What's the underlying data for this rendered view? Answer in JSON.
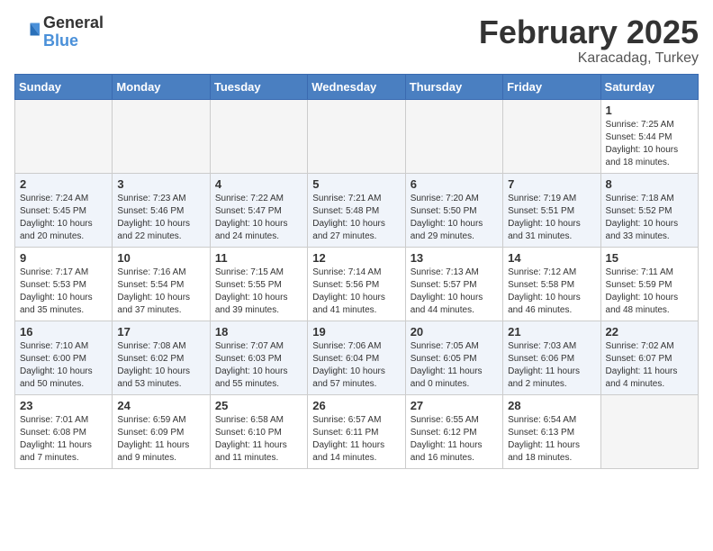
{
  "header": {
    "logo_general": "General",
    "logo_blue": "Blue",
    "month_title": "February 2025",
    "location": "Karacadag, Turkey"
  },
  "weekdays": [
    "Sunday",
    "Monday",
    "Tuesday",
    "Wednesday",
    "Thursday",
    "Friday",
    "Saturday"
  ],
  "weeks": [
    [
      {
        "day": "",
        "info": ""
      },
      {
        "day": "",
        "info": ""
      },
      {
        "day": "",
        "info": ""
      },
      {
        "day": "",
        "info": ""
      },
      {
        "day": "",
        "info": ""
      },
      {
        "day": "",
        "info": ""
      },
      {
        "day": "1",
        "info": "Sunrise: 7:25 AM\nSunset: 5:44 PM\nDaylight: 10 hours and 18 minutes."
      }
    ],
    [
      {
        "day": "2",
        "info": "Sunrise: 7:24 AM\nSunset: 5:45 PM\nDaylight: 10 hours and 20 minutes."
      },
      {
        "day": "3",
        "info": "Sunrise: 7:23 AM\nSunset: 5:46 PM\nDaylight: 10 hours and 22 minutes."
      },
      {
        "day": "4",
        "info": "Sunrise: 7:22 AM\nSunset: 5:47 PM\nDaylight: 10 hours and 24 minutes."
      },
      {
        "day": "5",
        "info": "Sunrise: 7:21 AM\nSunset: 5:48 PM\nDaylight: 10 hours and 27 minutes."
      },
      {
        "day": "6",
        "info": "Sunrise: 7:20 AM\nSunset: 5:50 PM\nDaylight: 10 hours and 29 minutes."
      },
      {
        "day": "7",
        "info": "Sunrise: 7:19 AM\nSunset: 5:51 PM\nDaylight: 10 hours and 31 minutes."
      },
      {
        "day": "8",
        "info": "Sunrise: 7:18 AM\nSunset: 5:52 PM\nDaylight: 10 hours and 33 minutes."
      }
    ],
    [
      {
        "day": "9",
        "info": "Sunrise: 7:17 AM\nSunset: 5:53 PM\nDaylight: 10 hours and 35 minutes."
      },
      {
        "day": "10",
        "info": "Sunrise: 7:16 AM\nSunset: 5:54 PM\nDaylight: 10 hours and 37 minutes."
      },
      {
        "day": "11",
        "info": "Sunrise: 7:15 AM\nSunset: 5:55 PM\nDaylight: 10 hours and 39 minutes."
      },
      {
        "day": "12",
        "info": "Sunrise: 7:14 AM\nSunset: 5:56 PM\nDaylight: 10 hours and 41 minutes."
      },
      {
        "day": "13",
        "info": "Sunrise: 7:13 AM\nSunset: 5:57 PM\nDaylight: 10 hours and 44 minutes."
      },
      {
        "day": "14",
        "info": "Sunrise: 7:12 AM\nSunset: 5:58 PM\nDaylight: 10 hours and 46 minutes."
      },
      {
        "day": "15",
        "info": "Sunrise: 7:11 AM\nSunset: 5:59 PM\nDaylight: 10 hours and 48 minutes."
      }
    ],
    [
      {
        "day": "16",
        "info": "Sunrise: 7:10 AM\nSunset: 6:00 PM\nDaylight: 10 hours and 50 minutes."
      },
      {
        "day": "17",
        "info": "Sunrise: 7:08 AM\nSunset: 6:02 PM\nDaylight: 10 hours and 53 minutes."
      },
      {
        "day": "18",
        "info": "Sunrise: 7:07 AM\nSunset: 6:03 PM\nDaylight: 10 hours and 55 minutes."
      },
      {
        "day": "19",
        "info": "Sunrise: 7:06 AM\nSunset: 6:04 PM\nDaylight: 10 hours and 57 minutes."
      },
      {
        "day": "20",
        "info": "Sunrise: 7:05 AM\nSunset: 6:05 PM\nDaylight: 11 hours and 0 minutes."
      },
      {
        "day": "21",
        "info": "Sunrise: 7:03 AM\nSunset: 6:06 PM\nDaylight: 11 hours and 2 minutes."
      },
      {
        "day": "22",
        "info": "Sunrise: 7:02 AM\nSunset: 6:07 PM\nDaylight: 11 hours and 4 minutes."
      }
    ],
    [
      {
        "day": "23",
        "info": "Sunrise: 7:01 AM\nSunset: 6:08 PM\nDaylight: 11 hours and 7 minutes."
      },
      {
        "day": "24",
        "info": "Sunrise: 6:59 AM\nSunset: 6:09 PM\nDaylight: 11 hours and 9 minutes."
      },
      {
        "day": "25",
        "info": "Sunrise: 6:58 AM\nSunset: 6:10 PM\nDaylight: 11 hours and 11 minutes."
      },
      {
        "day": "26",
        "info": "Sunrise: 6:57 AM\nSunset: 6:11 PM\nDaylight: 11 hours and 14 minutes."
      },
      {
        "day": "27",
        "info": "Sunrise: 6:55 AM\nSunset: 6:12 PM\nDaylight: 11 hours and 16 minutes."
      },
      {
        "day": "28",
        "info": "Sunrise: 6:54 AM\nSunset: 6:13 PM\nDaylight: 11 hours and 18 minutes."
      },
      {
        "day": "",
        "info": ""
      }
    ]
  ]
}
